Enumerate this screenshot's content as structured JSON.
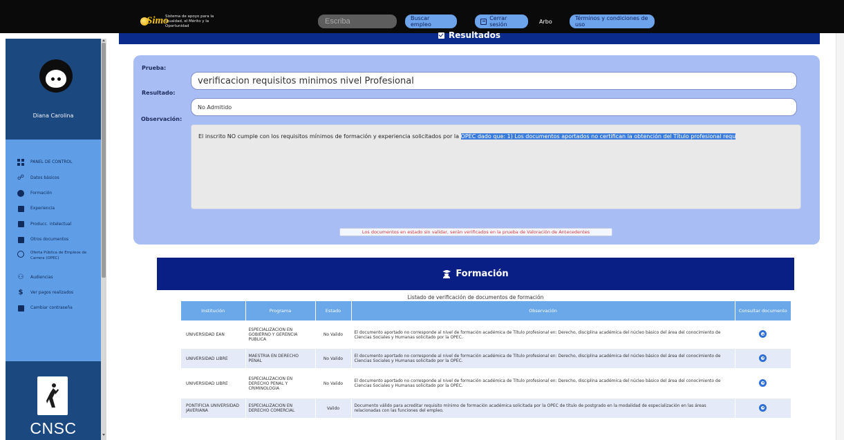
{
  "topbar": {
    "logo_text": "Simo",
    "logo_tagline": "Sistema de apoyo para la Igualdad, el Mérito y la Oportunidad",
    "search_placeholder": "Escriba",
    "search_button": "Buscar empleo",
    "logout_button": "Cerrar sesión",
    "arbo_label": "Arbo",
    "terms_button": "Términos y condiciones de uso"
  },
  "sidebar": {
    "user_name": "Diana Carolina",
    "items": [
      {
        "label": "PANEL DE CONTROL",
        "icon": "dashboard-icon"
      },
      {
        "label": "Datos básicos",
        "icon": "user-data-icon"
      },
      {
        "label": "Formación",
        "icon": "graduation-icon"
      },
      {
        "label": "Experiencia",
        "icon": "briefcase-icon"
      },
      {
        "label": "Producc. intelectual",
        "icon": "book-icon"
      },
      {
        "label": "Otros documentos",
        "icon": "document-icon"
      },
      {
        "label": "Oferta Pública de Empleos de Carrera (OPEC)",
        "icon": "globe-icon"
      },
      {
        "label": "Audiencias",
        "icon": "people-icon"
      },
      {
        "label": "Ver pagos realizados",
        "icon": "dollar-icon"
      },
      {
        "label": "Cambiar contraseña",
        "icon": "lock-icon"
      }
    ],
    "org_logo_text": "CNSC"
  },
  "results": {
    "section_title": "Resultados",
    "prueba_label": "Prueba:",
    "prueba_value": "verificacion requisitos minimos nivel Profesional",
    "resultado_label": "Resultado:",
    "resultado_value": "No Admitido",
    "observacion_label": "Observación:",
    "observacion_text_plain": "El inscrito NO cumple con los requisitos mínimos de formación y experiencia solicitados por la ",
    "observacion_text_selected": "OPEC dado que: 1) Los documentos aportados no certifican la obtención del Título profesional requ",
    "notice": "Los documentos en estado sin validar, serán verificados en la prueba de Valoración de Antecedentes"
  },
  "formacion": {
    "title": "Formación",
    "subtitle": "Listado de verificación de documentos de formación",
    "columns": [
      "Institución",
      "Programa",
      "Estado",
      "Observación",
      "Consultar documento"
    ],
    "rows": [
      {
        "institucion": "UNIVERSIDAD EAN",
        "programa": "ESPECIALIZACION EN GOBIERNO Y GERENCIA PUBLICA",
        "estado": "No Valido",
        "observacion": "El documento aportado no corresponde al nivel de formación académica de Título profesional en: Derecho, disciplina académica del núcleo básico del área del conocimiento de Ciencias Sociales y Humanas solicitado por la OPEC."
      },
      {
        "institucion": "UNIVERSIDAD LIBRE",
        "programa": "MAESTRIA EN DERECHO PENAL",
        "estado": "No Valido",
        "observacion": "El documento aportado no corresponde al nivel de formación académica de Título profesional en: Derecho, disciplina académica del núcleo básico del área del conocimiento de Ciencias Sociales y Humanas solicitado por la OPEC."
      },
      {
        "institucion": "UNIVERSIDAD LIBRE",
        "programa": "ESPECIALIZACION EN DERECHO PENAL Y CRIMINOLOGIA",
        "estado": "No Valido",
        "observacion": "El documento aportado no corresponde al nivel de formación académica de Título profesional en: Derecho, disciplina académica del núcleo básico del área del conocimiento de Ciencias Sociales y Humanas solicitado por la OPEC."
      },
      {
        "institucion": "PONTIFICIA UNIVERSIDAD JAVERIANA",
        "programa": "ESPECIALIZACION EN DERECHO COMERCIAL",
        "estado": "Valido",
        "observacion": "Documento válido para acreditar requisito mínimo de formación académica solicitada por la OPEC de título de postgrado en la modalidad de especialización en las áreas relacionadas con las funciones del empleo."
      }
    ]
  },
  "colors": {
    "topbar_bg": "#0a0a0a",
    "sidebar_bg": "#5f9ee6",
    "profile_bg": "#1c4880",
    "header_navy": "#0a1f85",
    "panel_bg": "#a9bdf5",
    "table_header": "#6aa8ea",
    "notice_red": "#d43a3a"
  }
}
